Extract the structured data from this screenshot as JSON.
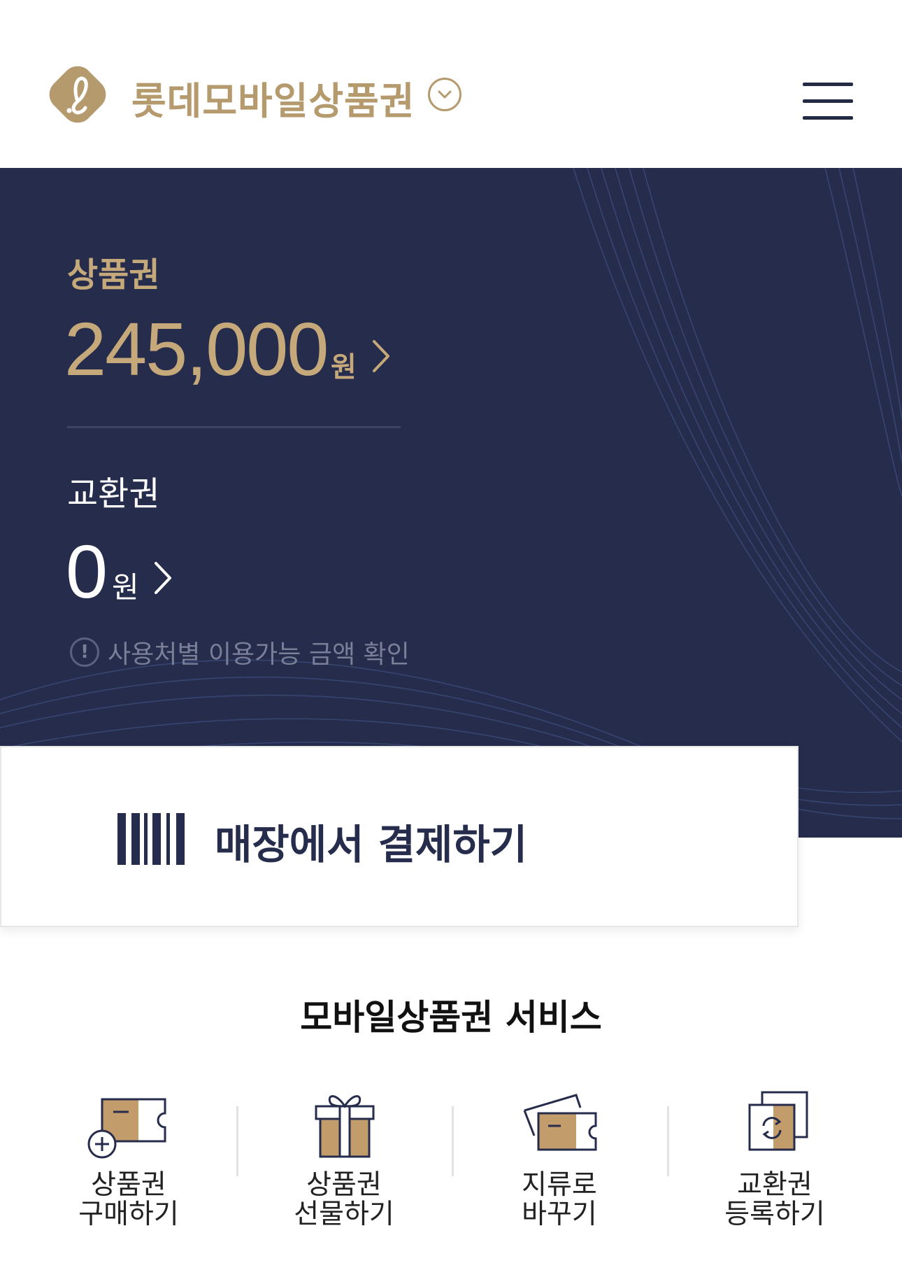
{
  "header": {
    "brand_title": "롯데모바일상품권",
    "icons": {
      "logo": "lotte-l-logo",
      "chevron": "chevron-down-icon",
      "menu": "hamburger-menu-icon"
    }
  },
  "balance": {
    "voucher_label": "상품권",
    "voucher_amount": "245,000",
    "voucher_unit": "원",
    "exchange_label": "교환권",
    "exchange_amount": "0",
    "exchange_unit": "원",
    "info_text": "사용처별 이용가능 금액 확인"
  },
  "pay": {
    "label": "매장에서 결제하기",
    "icon": "barcode-icon"
  },
  "service": {
    "title": "모바일상품권 서비스",
    "items": [
      {
        "line1": "상품권",
        "line2": "구매하기",
        "icon": "ticket-add-icon"
      },
      {
        "line1": "상품권",
        "line2": "선물하기",
        "icon": "gift-icon"
      },
      {
        "line1": "지류로",
        "line2": "바꾸기",
        "icon": "paper-voucher-icon"
      },
      {
        "line1": "교환권",
        "line2": "등록하기",
        "icon": "exchange-register-icon"
      }
    ]
  },
  "colors": {
    "navy": "#262c4c",
    "gold": "#c6a97a",
    "brand_gold": "#b59a6e"
  }
}
